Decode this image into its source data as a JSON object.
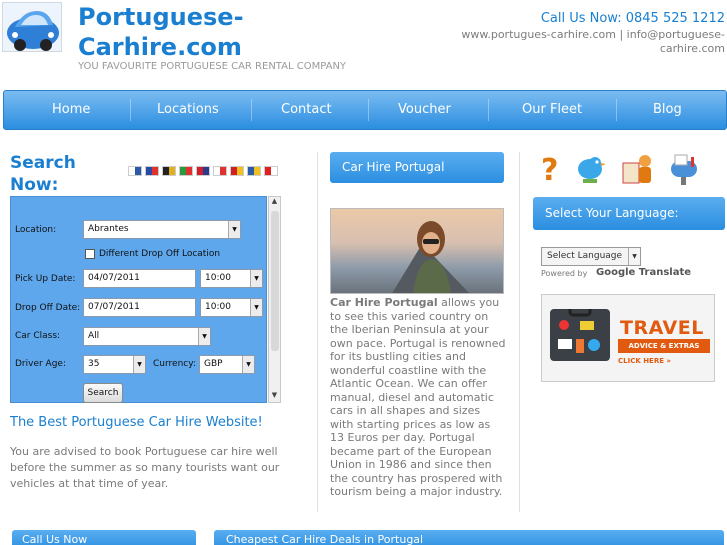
{
  "header": {
    "title_line1": "Portuguese-",
    "title_line2": "Carhire.com",
    "tagline": "YOU FAVOURITE PORTUGUESE CAR RENTAL COMPANY",
    "call_us": "Call Us Now: 0845 525 1212",
    "contact_line": "www.portugues-carhire.com | info@portuguese-carhire.com"
  },
  "nav": {
    "items": [
      "Home",
      "Locations",
      "Contact",
      "Voucher",
      "Our Fleet",
      "Blog"
    ]
  },
  "search": {
    "title": "Search Now:",
    "flags": [
      {
        "name": "finland",
        "c1": "#ffffff",
        "c2": "#2b5aa8"
      },
      {
        "name": "france",
        "c1": "#2b4aa8",
        "c2": "#e03030"
      },
      {
        "name": "germany",
        "c1": "#222222",
        "c2": "#e0b020"
      },
      {
        "name": "italy",
        "c1": "#2a9a3a",
        "c2": "#e03030"
      },
      {
        "name": "norway",
        "c1": "#d02030",
        "c2": "#2b3a88"
      },
      {
        "name": "poland",
        "c1": "#ffffff",
        "c2": "#e03030"
      },
      {
        "name": "spain",
        "c1": "#d02020",
        "c2": "#f0c020"
      },
      {
        "name": "sweden",
        "c1": "#2b5aa8",
        "c2": "#f0c020"
      },
      {
        "name": "switzerland",
        "c1": "#e02020",
        "c2": "#ffffff"
      }
    ],
    "location_label": "Location:",
    "location_value": "Abrantes",
    "different_dropoff_label": "Different Drop Off Location",
    "pickup_label": "Pick Up Date:",
    "pickup_date": "04/07/2011",
    "pickup_time": "10:00",
    "dropoff_label": "Drop Off Date:",
    "dropoff_date": "07/07/2011",
    "dropoff_time": "10:00",
    "car_class_label": "Car Class:",
    "car_class_value": "All",
    "driver_age_label": "Driver Age:",
    "driver_age_value": "35",
    "currency_label": "Currency:",
    "currency_value": "GBP",
    "search_button": "Search"
  },
  "best": {
    "title": "The Best Portuguese Car Hire Website!",
    "text": "You are advised to book Portuguese car hire well before the summer as so many tourists want our vehicles at that time of year."
  },
  "middle": {
    "tab": "Car Hire Portugal",
    "text_bold": "Car Hire Portugal",
    "text_rest": " allows you to see this varied country on the Iberian Peninsula at your own pace. Portugal is renowned for its bustling cities and wonderful coastline with the Atlantic Ocean. We can offer manual, diesel and automatic cars in all shapes and sizes with starting prices as low as 13 Euros per day. Portugal became part of the European Union in 1986 and since then the country has prospered with tourism being a major industry."
  },
  "right": {
    "social_icons": [
      "help-icon",
      "twitter-bird-icon",
      "contact-person-icon",
      "mailbox-icon"
    ],
    "language_tab": "Select Your Language:",
    "language_select": "Select Language",
    "powered_by": "Powered by",
    "google_translate": "Google Translate",
    "travel_title": "TRAVEL",
    "travel_sub": "ADVICE & EXTRAS",
    "travel_click": "CLICK HERE »"
  },
  "bottom": {
    "tab_left": "Call Us Now",
    "tab_right": "Cheapest Car Hire Deals in Portugal"
  },
  "colors": {
    "brand_blue": "#1a7fd0",
    "nav_gradient_top": "#7bbcf1",
    "nav_gradient_bottom": "#2b8ee0",
    "form_bg": "#5ea7ec",
    "travel_orange": "#e15a0f"
  }
}
